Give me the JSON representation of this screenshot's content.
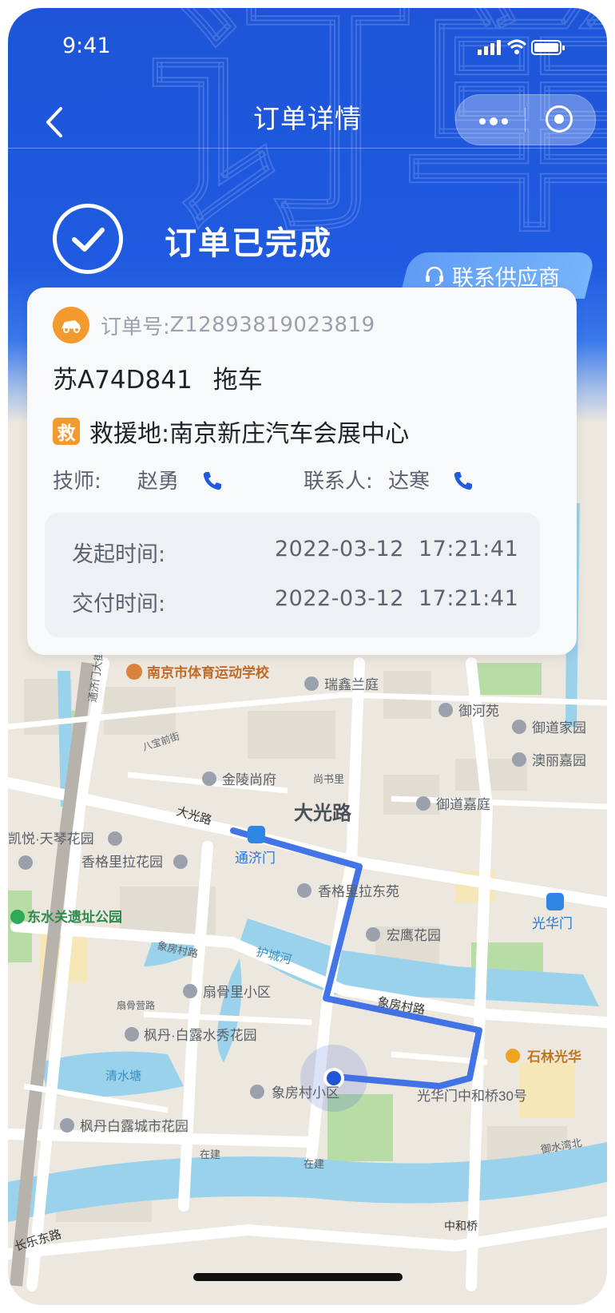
{
  "status_bar": {
    "time": "9:41"
  },
  "nav": {
    "title": "订单详情"
  },
  "status": {
    "text": "订单已完成",
    "contact_supplier": "联系供应商"
  },
  "order": {
    "number_label": "订单号:",
    "number": "Z12893819023819",
    "plate": "苏A74D841",
    "service": "拖车",
    "rescue_badge": "救",
    "rescue_label": "救援地:",
    "rescue_place": "南京新庄汽车会展中心",
    "technician_label": "技师:",
    "technician": "赵勇",
    "contact_label": "联系人:",
    "contact": "达寒",
    "start_label": "发起时间:",
    "start_date": "2022-03-12",
    "start_time": "17:21:41",
    "deliver_label": "交付时间:",
    "deliver_date": "2022-03-12",
    "deliver_time": "17:21:41"
  },
  "map": {
    "labels": {
      "school": "南京市体育运动学校",
      "ruixin": "瑞鑫兰庭",
      "yuhe": "御河苑",
      "yudao_home": "御道家园",
      "aoli": "澳丽嘉园",
      "yudao_jia": "御道嘉庭",
      "jinling": "金陵尚府",
      "shangshu": "尚书里",
      "dadaolu_road": "大光路",
      "baobao": "八宝前街",
      "dagong_big": "大光路",
      "tongji": "通济门",
      "xiangge": "香格里拉花园",
      "qinyue": "凯悦·天琴花园",
      "xiangge_east": "香格里拉东苑",
      "guanghua": "光华门",
      "dongshui": "东水关遗址公园",
      "honying": "宏鹰花园",
      "xiangfang1": "象房村路",
      "huchenghe": "护城河",
      "shangu": "扇骨里小区",
      "xiangfang2": "象房村路",
      "shangu_road": "扇骨营路",
      "fengdan": "枫丹·白露水秀花园",
      "shilin": "石林光华",
      "qingshui": "清水塘",
      "xiangfang_village": "象房村小区",
      "zhonghe30": "光华门中和桥30号",
      "fengdan_city": "枫丹白露城市花园",
      "zaijian1": "在建",
      "zaijian2": "在建",
      "yushui": "御水湾北",
      "changle": "长乐东路",
      "zhonghe_bridge": "中和桥",
      "tongjimen_road": "通济门大街"
    }
  },
  "colors": {
    "primary": "#1f5ae0",
    "accent": "#f39a2f",
    "route": "#2f66e6"
  }
}
